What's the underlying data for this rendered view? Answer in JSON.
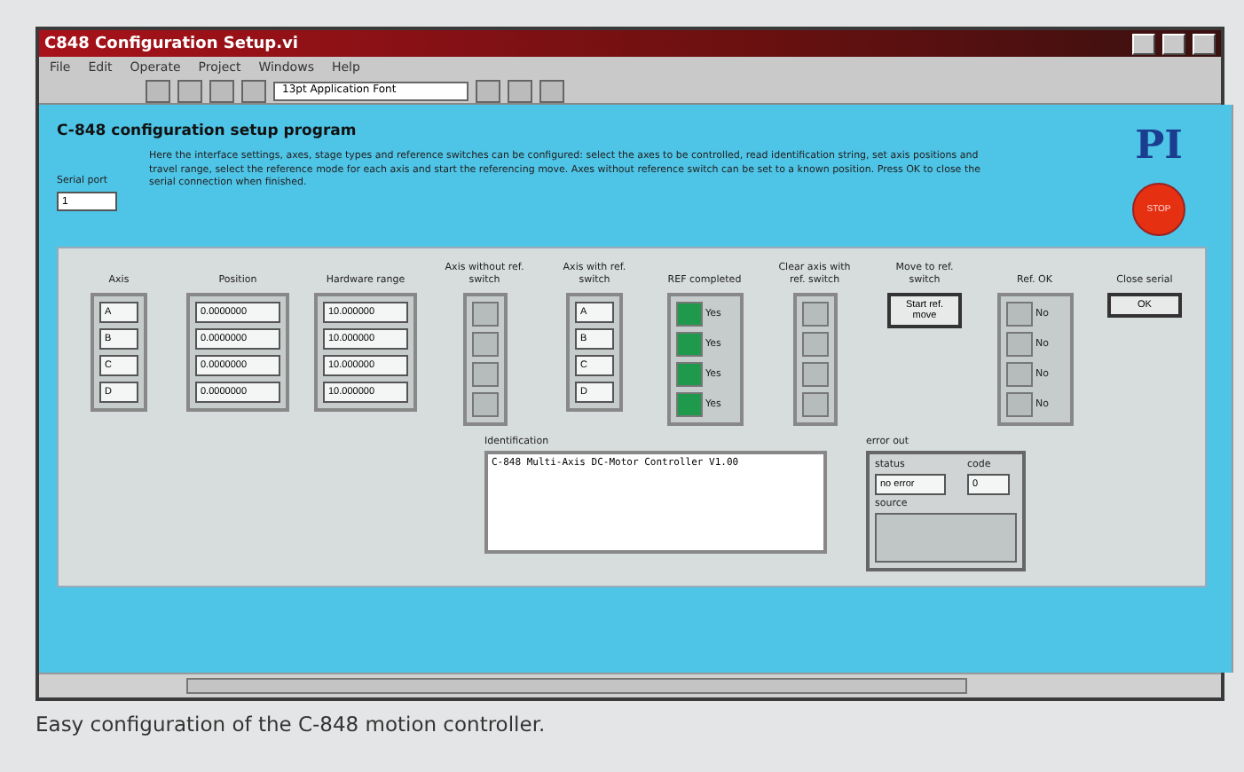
{
  "window": {
    "title": "C848 Configuration Setup.vi"
  },
  "menu": [
    "File",
    "Edit",
    "Operate",
    "Project",
    "Windows",
    "Help"
  ],
  "toolbar": {
    "font": "13pt Application Font"
  },
  "program": {
    "title": "C-848 configuration setup program",
    "logo": "PI",
    "stop": "STOP",
    "description": "Here the interface settings, axes, stage types and reference switches can be configured: select the axes to be controlled, read identification string, set axis positions and travel range, select the reference mode for each axis and start the referencing move. Axes without reference switch can be set to a known position. Press OK to close the serial connection when finished.",
    "port_label": "Serial port",
    "port_value": "1"
  },
  "columns": [
    {
      "kind": "field",
      "header": "Axis",
      "values": [
        "A",
        "B",
        "C",
        "D"
      ]
    },
    {
      "kind": "field",
      "header": "Position",
      "values": [
        "0.0000000",
        "0.0000000",
        "0.0000000",
        "0.0000000"
      ]
    },
    {
      "kind": "field",
      "header": "Hardware range",
      "values": [
        "10.000000",
        "10.000000",
        "10.000000",
        "10.000000"
      ]
    },
    {
      "kind": "led",
      "header": "Axis without ref. switch",
      "leds": [
        {
          "on": false
        },
        {
          "on": false
        },
        {
          "on": false
        },
        {
          "on": false
        }
      ]
    },
    {
      "kind": "field",
      "header": "Axis with ref. switch",
      "values": [
        "A",
        "B",
        "C",
        "D"
      ]
    },
    {
      "kind": "led",
      "header": "REF completed",
      "leds": [
        {
          "on": true,
          "label": "Yes"
        },
        {
          "on": true,
          "label": "Yes"
        },
        {
          "on": true,
          "label": "Yes"
        },
        {
          "on": true,
          "label": "Yes"
        }
      ]
    },
    {
      "kind": "led",
      "header": "Clear axis with ref. switch",
      "leds": [
        {
          "on": false
        },
        {
          "on": false
        },
        {
          "on": false
        },
        {
          "on": false
        }
      ]
    },
    {
      "kind": "button",
      "header": "Move to ref. switch",
      "label": "Start ref. move"
    },
    {
      "kind": "led",
      "header": "Ref. OK",
      "leds": [
        {
          "on": false,
          "label": "No"
        },
        {
          "on": false,
          "label": "No"
        },
        {
          "on": false,
          "label": "No"
        },
        {
          "on": false,
          "label": "No"
        }
      ]
    },
    {
      "kind": "button",
      "header": "Close serial",
      "label": "OK"
    }
  ],
  "identification": {
    "label": "Identification",
    "value": "C-848 Multi-Axis DC-Motor Controller V1.00"
  },
  "error": {
    "label": "error out",
    "status_label": "status",
    "code_label": "code",
    "status": "no error",
    "code": "0",
    "source_label": "source"
  },
  "caption": "Easy configuration of the C-848 motion controller."
}
